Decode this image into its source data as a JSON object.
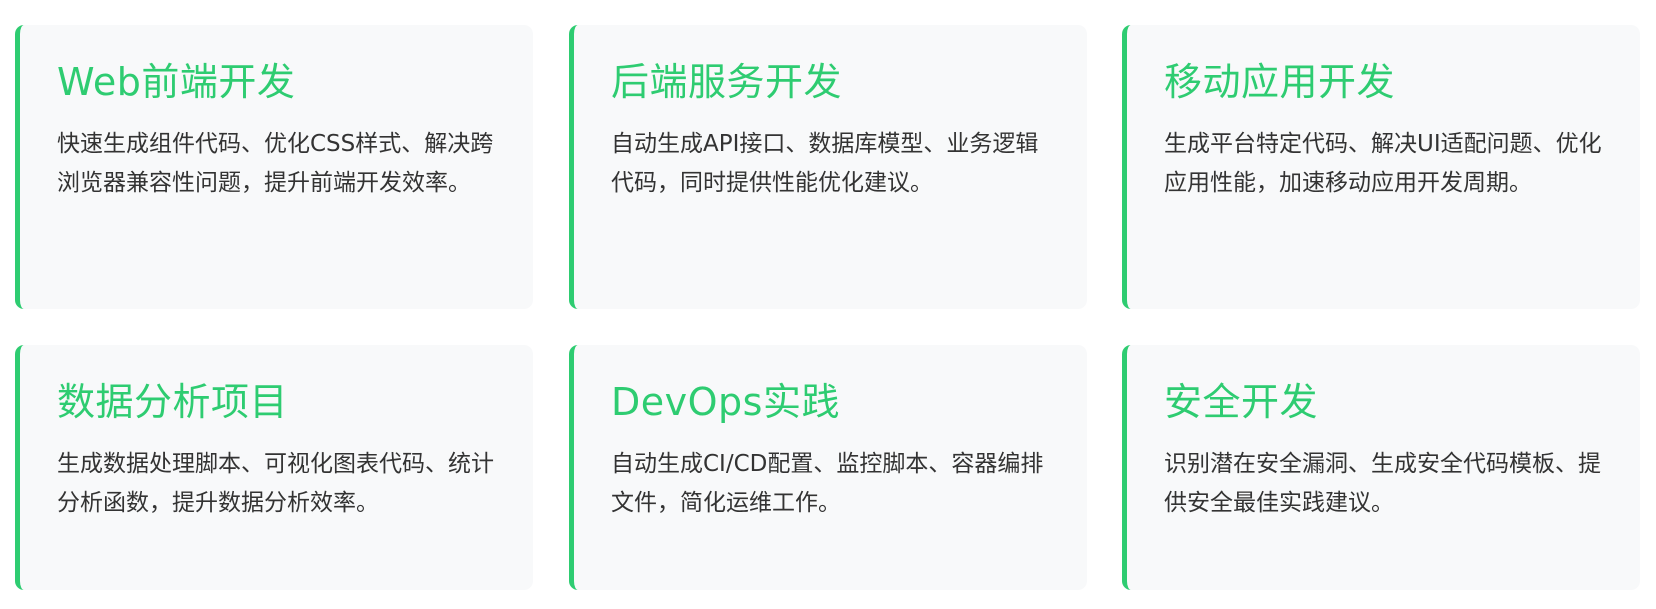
{
  "accent_color": "#2ecc71",
  "cards": [
    {
      "title": "Web前端开发",
      "description": "快速生成组件代码、优化CSS样式、解决跨浏览器兼容性问题，提升前端开发效率。"
    },
    {
      "title": "后端服务开发",
      "description": "自动生成API接口、数据库模型、业务逻辑代码，同时提供性能优化建议。"
    },
    {
      "title": "移动应用开发",
      "description": "生成平台特定代码、解决UI适配问题、优化应用性能，加速移动应用开发周期。"
    },
    {
      "title": "数据分析项目",
      "description": "生成数据处理脚本、可视化图表代码、统计分析函数，提升数据分析效率。"
    },
    {
      "title": "DevOps实践",
      "description": "自动生成CI/CD配置、监控脚本、容器编排文件，简化运维工作。"
    },
    {
      "title": "安全开发",
      "description": "识别潜在安全漏洞、生成安全代码模板、提供安全最佳实践建议。"
    }
  ]
}
